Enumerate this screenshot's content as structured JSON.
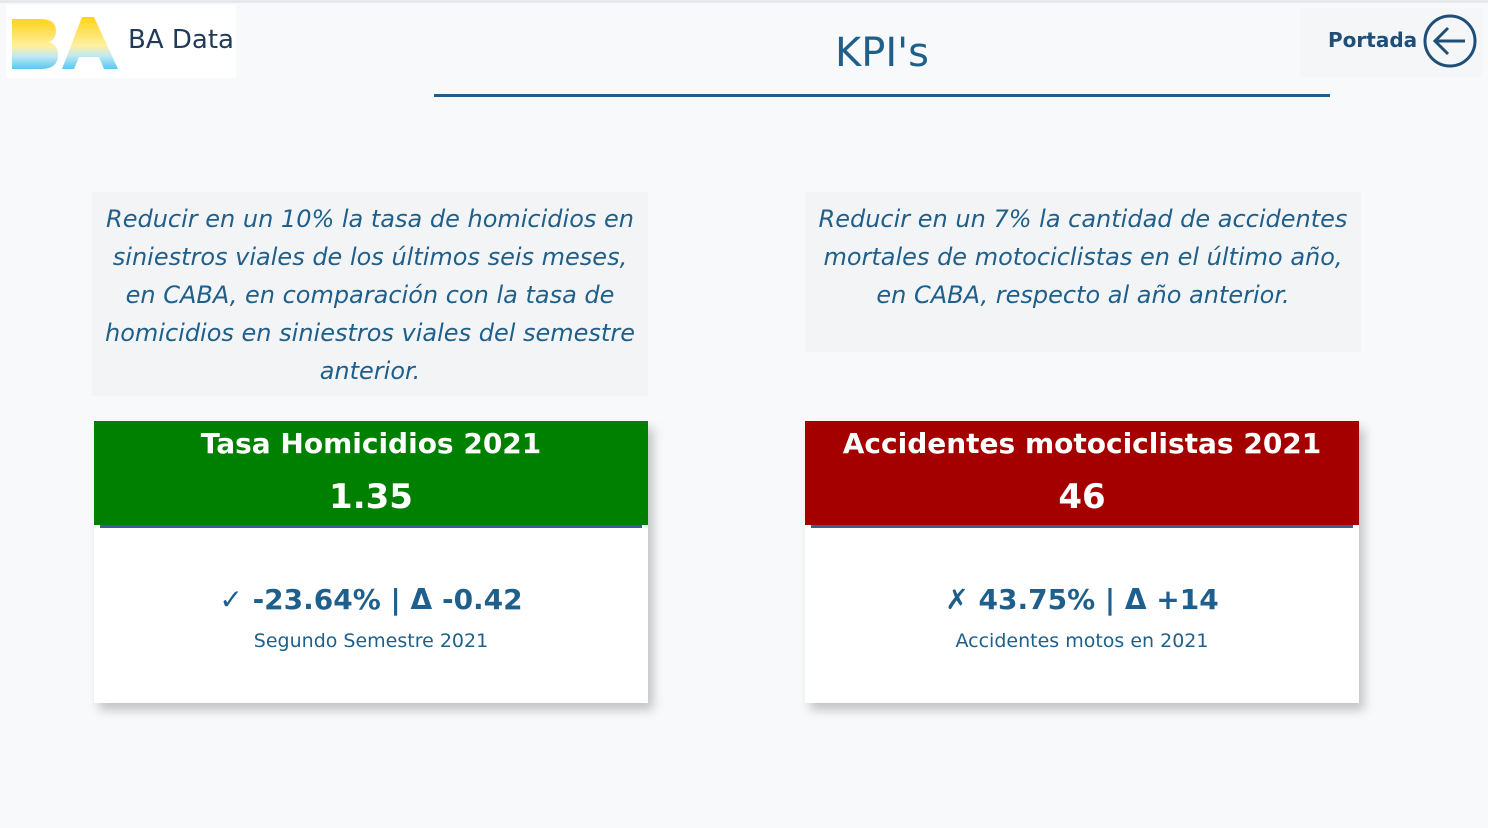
{
  "header": {
    "logo_text": "BA Data",
    "page_title": "KPI's",
    "back_nav_label": "Portada",
    "back_icon": "arrow-left-circle-icon"
  },
  "goals": [
    {
      "text": "Reducir en un 10% la tasa de homicidios en siniestros viales de los últimos seis meses, en CABA, en comparación con la tasa de homicidios en siniestros viales del semestre anterior."
    },
    {
      "text": "Reducir en un 7% la cantidad de accidentes mortales de motociclistas en el último año, en CABA, respecto al año anterior."
    }
  ],
  "kpis": [
    {
      "title": "Tasa Homicidios 2021",
      "value": "1.35",
      "status_mark": "✓",
      "change": "-23.64% | Δ -0.42",
      "subtitle": "Segundo Semestre 2021",
      "header_color": "#008000"
    },
    {
      "title": "Accidentes motociclistas 2021",
      "value": "46",
      "status_mark": "✗",
      "change": "43.75% | Δ +14",
      "subtitle": "Accidentes motos en 2021",
      "header_color": "#a50000"
    }
  ],
  "colors": {
    "accent": "#1f5f8b",
    "nav_text": "#1f4e79"
  }
}
